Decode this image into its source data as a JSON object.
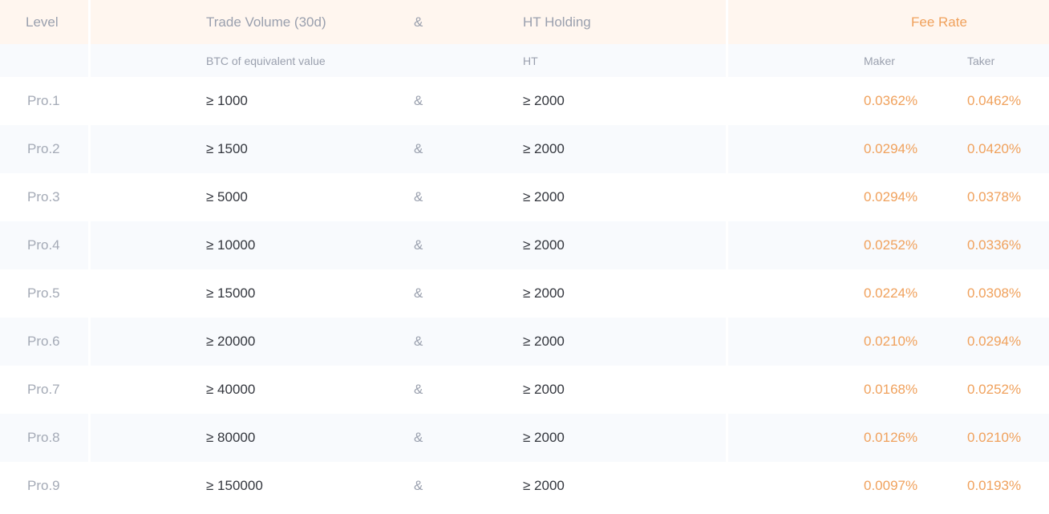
{
  "header": {
    "level": "Level",
    "trade_volume": "Trade Volume (30d)",
    "and": "&",
    "ht_holding": "HT Holding",
    "fee_rate": "Fee Rate"
  },
  "subheader": {
    "trade_volume_unit": "BTC of equivalent value",
    "ht_unit": "HT",
    "maker": "Maker",
    "taker": "Taker"
  },
  "rows": [
    {
      "level": "Pro.1",
      "volume": "≥ 1000",
      "and": "&",
      "ht": "≥ 2000",
      "maker": "0.0362%",
      "taker": "0.0462%"
    },
    {
      "level": "Pro.2",
      "volume": "≥ 1500",
      "and": "&",
      "ht": "≥ 2000",
      "maker": "0.0294%",
      "taker": "0.0420%"
    },
    {
      "level": "Pro.3",
      "volume": "≥ 5000",
      "and": "&",
      "ht": "≥ 2000",
      "maker": "0.0294%",
      "taker": "0.0378%"
    },
    {
      "level": "Pro.4",
      "volume": "≥ 10000",
      "and": "&",
      "ht": "≥ 2000",
      "maker": "0.0252%",
      "taker": "0.0336%"
    },
    {
      "level": "Pro.5",
      "volume": "≥ 15000",
      "and": "&",
      "ht": "≥ 2000",
      "maker": "0.0224%",
      "taker": "0.0308%"
    },
    {
      "level": "Pro.6",
      "volume": "≥ 20000",
      "and": "&",
      "ht": "≥ 2000",
      "maker": "0.0210%",
      "taker": "0.0294%"
    },
    {
      "level": "Pro.7",
      "volume": "≥ 40000",
      "and": "&",
      "ht": "≥ 2000",
      "maker": "0.0168%",
      "taker": "0.0252%"
    },
    {
      "level": "Pro.8",
      "volume": "≥ 80000",
      "and": "&",
      "ht": "≥ 2000",
      "maker": "0.0126%",
      "taker": "0.0210%"
    },
    {
      "level": "Pro.9",
      "volume": "≥ 150000",
      "and": "&",
      "ht": "≥ 2000",
      "maker": "0.0097%",
      "taker": "0.0193%"
    }
  ],
  "colors": {
    "accent": "#f0a15c",
    "header_bg": "#fff6ef",
    "alt_row_bg": "#f8fafd",
    "muted_text": "#9aa0ae",
    "value_text": "#33363d"
  }
}
